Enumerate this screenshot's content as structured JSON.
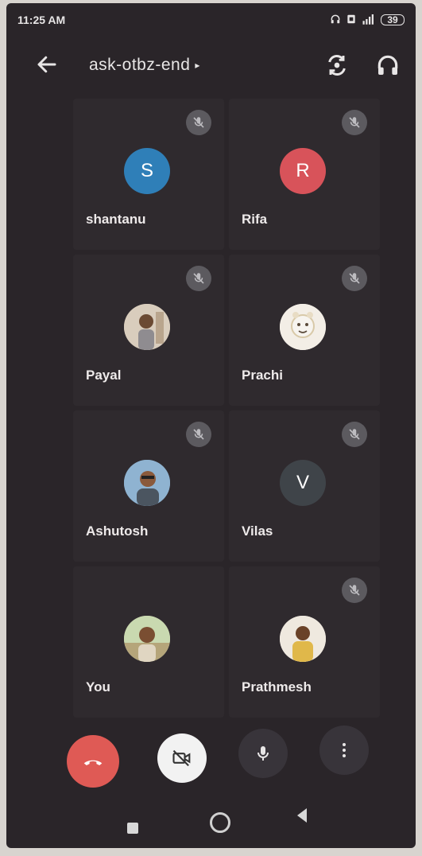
{
  "status": {
    "time": "11:25 AM",
    "battery": "39",
    "icons": [
      "headphone-icon",
      "sim-icon",
      "signal-icon"
    ]
  },
  "header": {
    "meeting_code": "ask-otbz-end",
    "caret": "▸",
    "back_icon": "arrow-left-icon",
    "switch_camera_icon": "switch-camera-icon",
    "audio_icon": "headphones-icon"
  },
  "participants": [
    {
      "name": "shantanu",
      "initial": "S",
      "avatar_color": "#2f7fb8",
      "muted": true
    },
    {
      "name": "Rifa",
      "initial": "R",
      "avatar_color": "#d8535a",
      "muted": true
    },
    {
      "name": "Payal",
      "initial": "",
      "avatar_color": "#c7b5a0",
      "muted": true
    },
    {
      "name": "Prachi",
      "initial": "",
      "avatar_color": "#f3eee6",
      "muted": true
    },
    {
      "name": "Ashutosh",
      "initial": "",
      "avatar_color": "#7b9fbf",
      "muted": true
    },
    {
      "name": "Vilas",
      "initial": "V",
      "avatar_color": "#3f4449",
      "muted": true
    },
    {
      "name": "You",
      "initial": "",
      "avatar_color": "#d8c8a8",
      "muted": false
    },
    {
      "name": "Prathmesh",
      "initial": "",
      "avatar_color": "#e6e0d8",
      "muted": true
    }
  ],
  "controls": {
    "end_call_icon": "phone-hangup-icon",
    "camera_off_icon": "camera-off-icon",
    "mic_icon": "mic-icon",
    "more_icon": "more-vert-icon"
  },
  "colors": {
    "end_call": "#df5a55",
    "background": "#2a2529",
    "mute_badge": "#5c5a5f"
  }
}
